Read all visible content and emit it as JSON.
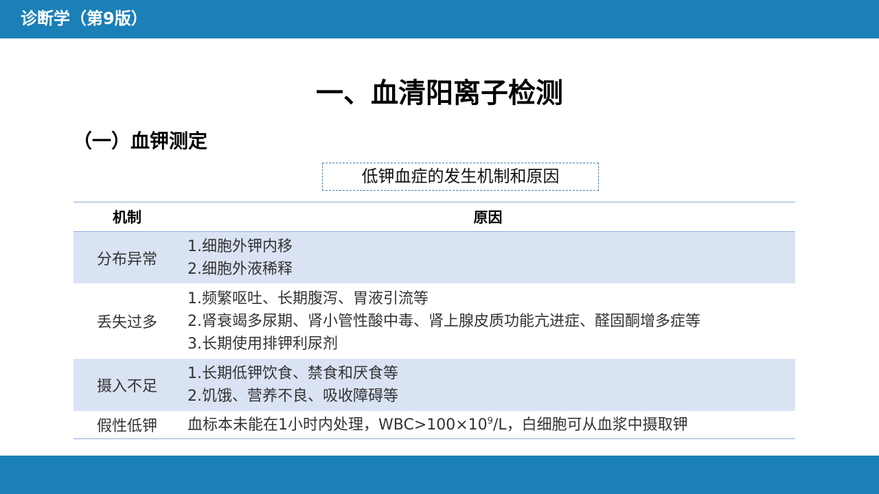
{
  "header": {
    "title": "诊断学（第9版）"
  },
  "main_title": "一、血清阳离子检测",
  "section_title": "（一）血钾测定",
  "table_caption": "低钾血症的发生机制和原因",
  "table": {
    "headers": {
      "mechanism": "机制",
      "reason": "原因"
    },
    "rows": [
      {
        "mechanism": "分布异常",
        "reasons": [
          "1.细胞外钾内移",
          "2.细胞外液稀释"
        ]
      },
      {
        "mechanism": "丢失过多",
        "reasons": [
          "1.频繁呕吐、长期腹泻、胃液引流等",
          "2.肾衰竭多尿期、肾小管性酸中毒、肾上腺皮质功能亢进症、醛固酮增多症等",
          "3.长期使用排钾利尿剂"
        ]
      },
      {
        "mechanism": "摄入不足",
        "reasons": [
          "1.长期低钾饮食、禁食和厌食等",
          "2.饥饿、营养不良、吸收障碍等"
        ]
      },
      {
        "mechanism": "假性低钾",
        "reason_pre": "血标本未能在1小时内处理，WBC>100×10",
        "reason_sup": "9",
        "reason_post": "/L，白细胞可从血浆中摄取钾"
      }
    ]
  },
  "colors": {
    "bar": "#1b80b8",
    "row_shade": "#dae3f3",
    "rule": "#8eaadb",
    "caption_border": "#3a7fc1"
  }
}
